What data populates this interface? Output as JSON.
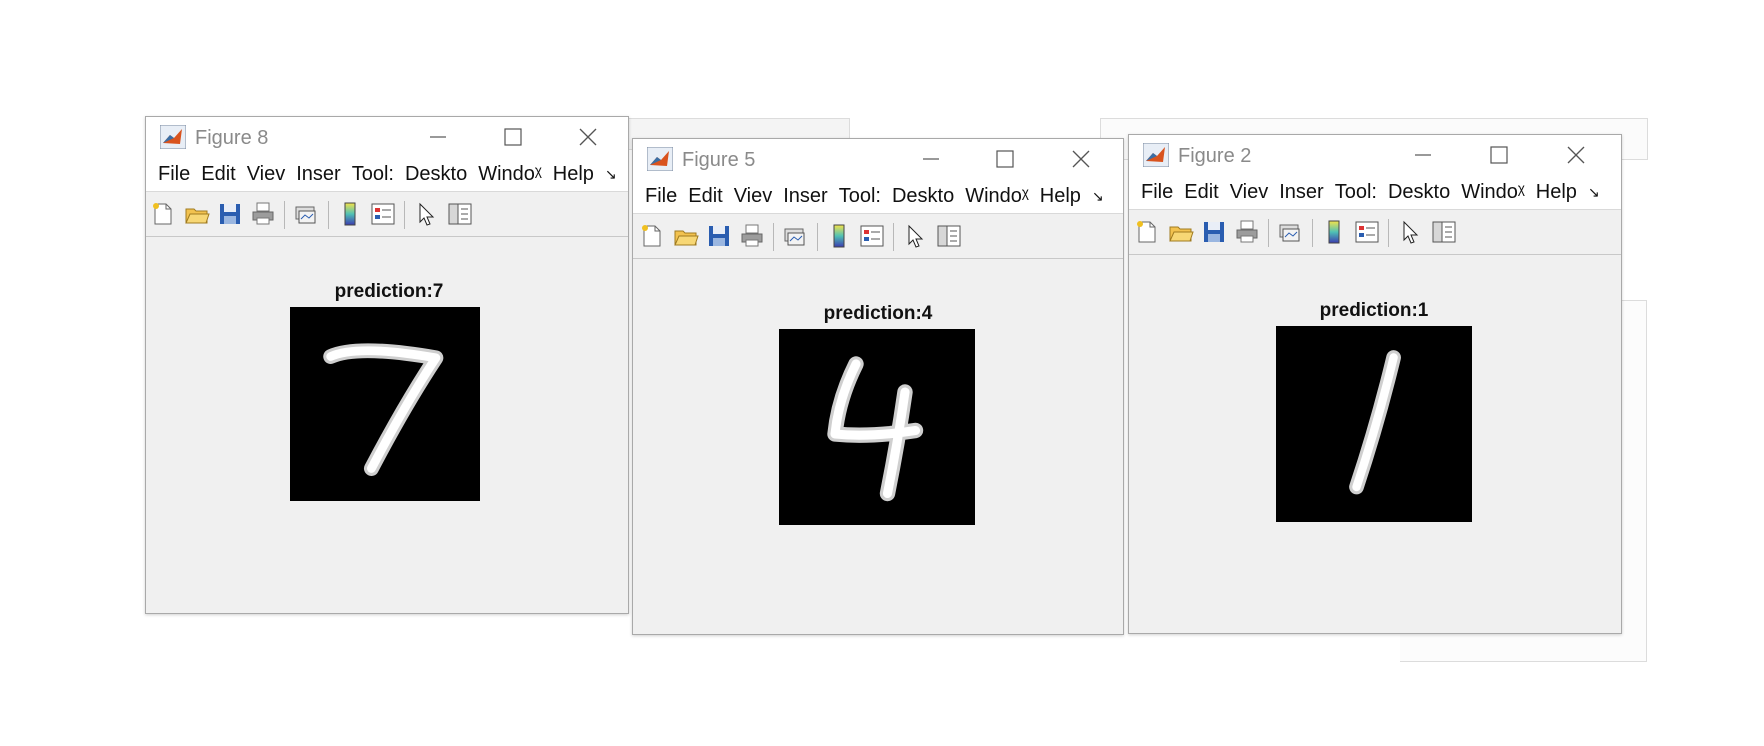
{
  "menu": [
    "File",
    "Edit",
    "Viev",
    "Inser",
    "Tool:",
    "Deskto",
    "Windoᵡ",
    "Help"
  ],
  "figures": [
    {
      "title": "Figure 8",
      "prediction": "prediction:7",
      "digit": "7"
    },
    {
      "title": "Figure 5",
      "prediction": "prediction:4",
      "digit": "4"
    },
    {
      "title": "Figure 2",
      "prediction": "prediction:1",
      "digit": "1"
    }
  ],
  "colors": {
    "window_bg": "#f0f0f0",
    "titlebar": "#ffffff",
    "image_bg": "#000000",
    "digit_stroke": "#ffffff"
  },
  "toolbar_icons": [
    "new-figure-icon",
    "open-file-icon",
    "save-icon",
    "print-icon",
    "link-plot-icon",
    "colorbar-icon",
    "legend-icon",
    "pointer-icon",
    "property-editor-icon"
  ]
}
